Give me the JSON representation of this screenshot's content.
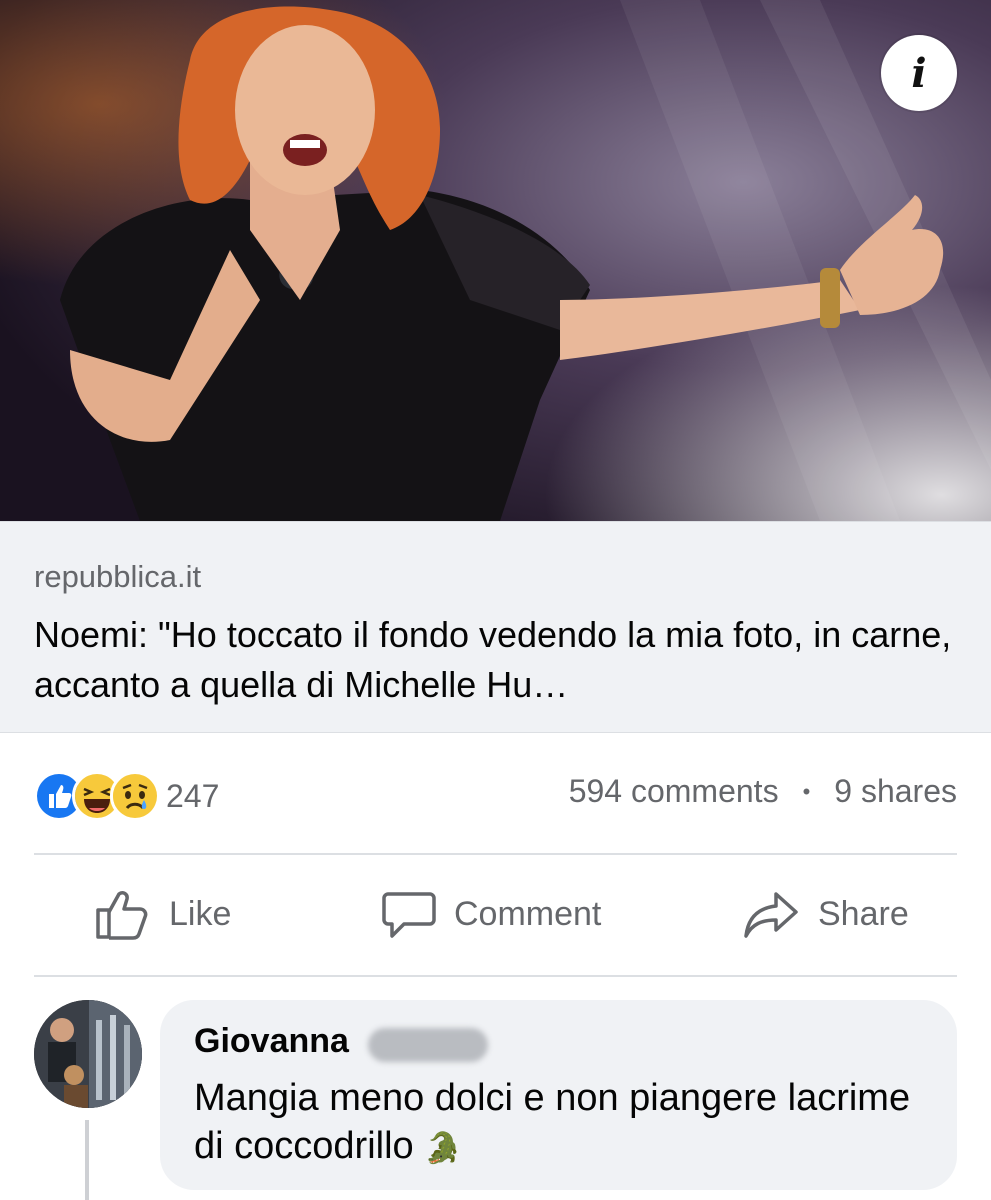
{
  "hero": {
    "image": "photo of a red-haired singer performing with a microphone",
    "info_icon": "info-icon"
  },
  "link_preview": {
    "domain": "repubblica.it",
    "headline": "Noemi: \"Ho toccato il fondo vedendo la mia foto, in carne, accanto a quella di Michelle Hu…"
  },
  "reactions": {
    "icons": [
      "like-reaction-icon",
      "haha-reaction-icon",
      "sad-reaction-icon"
    ],
    "count": "247"
  },
  "stats": {
    "comments": "594 comments",
    "separator": "•",
    "shares": "9 shares"
  },
  "actions": {
    "like": "Like",
    "comment": "Comment",
    "share": "Share"
  },
  "comment": {
    "author": "Giovanna",
    "text": "Mangia meno dolci e non piangere lacrime di coccodrillo",
    "emoji": "🐊"
  },
  "colors": {
    "like_blue": "#1877f2",
    "secondary_text": "#65676b",
    "bubble_bg": "#f0f2f5"
  }
}
